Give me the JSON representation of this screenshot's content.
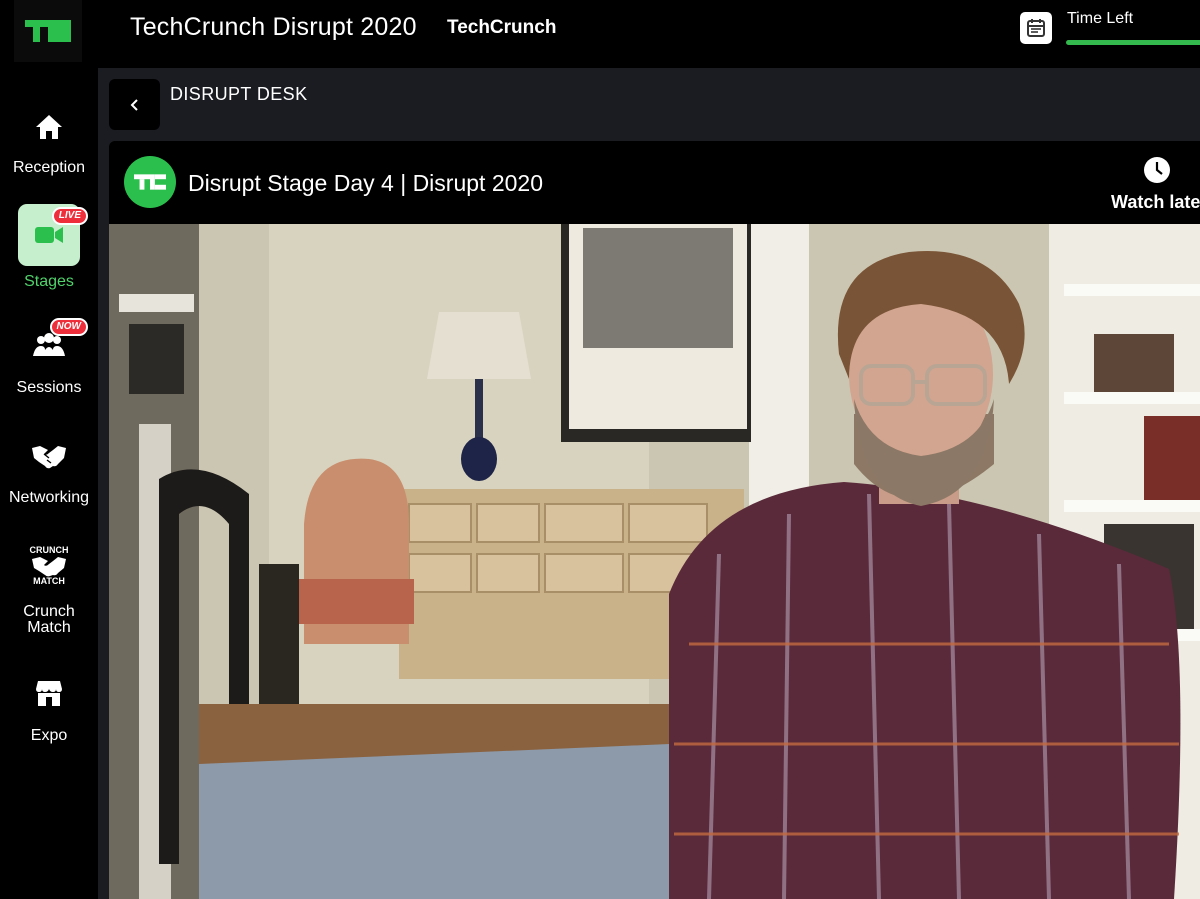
{
  "app": {
    "title": "TechCrunch Disrupt 2020",
    "org": "TechCrunch",
    "logo_text": "TC",
    "time_left_label": "Time Left",
    "time_left_progress": 1.0,
    "accent_color": "#33b94e"
  },
  "sidebar": {
    "items": [
      {
        "label": "Reception",
        "icon": "home-icon"
      },
      {
        "label": "Stages",
        "icon": "video-camera-icon",
        "badge": "LIVE",
        "active": true
      },
      {
        "label": "Sessions",
        "icon": "audience-icon",
        "badge": "NOW"
      },
      {
        "label": "Networking",
        "icon": "handshake-icon"
      },
      {
        "label": "Crunch\nMatch",
        "icon": "crunch-match-icon",
        "icon_top_text": "CRUNCH",
        "icon_bottom_text": "MATCH"
      },
      {
        "label": "Expo",
        "icon": "storefront-icon"
      }
    ]
  },
  "main": {
    "section_title": "DISRUPT DESK",
    "video": {
      "title": "Disrupt Stage Day 4 | Disrupt 2020",
      "channel_logo_text": "TC",
      "watch_later_label": "Watch later"
    }
  }
}
